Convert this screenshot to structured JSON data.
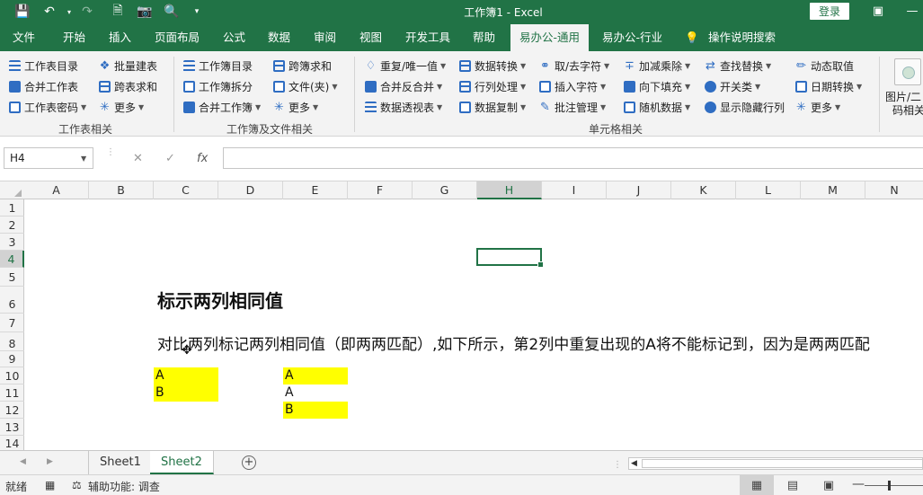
{
  "window": {
    "doc_title": "工作簿1  -  Excel",
    "login": "登录"
  },
  "ribbon_tabs": [
    "文件",
    "开始",
    "插入",
    "页面布局",
    "公式",
    "数据",
    "审阅",
    "视图",
    "开发工具",
    "帮助",
    "易办公-通用",
    "易办公-行业",
    "操作说明搜索"
  ],
  "ribbon": {
    "group1": {
      "label": "工作表相关",
      "items": [
        "工作表目录",
        "合并工作表",
        "工作表密码",
        "批量建表",
        "跨表求和",
        "更多"
      ]
    },
    "group2": {
      "label": "工作簿及文件相关",
      "items": [
        "工作簿目录",
        "工作簿拆分",
        "合并工作簿",
        "跨簿求和",
        "文件(夹)",
        "更多"
      ]
    },
    "group3": {
      "label": "单元格相关",
      "items": [
        "重复/唯一值",
        "合并反合并",
        "数据透视表",
        "数据转换",
        "行列处理",
        "数据复制",
        "取/去字符",
        "插入字符",
        "批注管理",
        "加减乘除",
        "向下填充",
        "随机数据",
        "查找替换",
        "开关类",
        "显示隐藏行列",
        "动态取值",
        "日期转换",
        "更多"
      ]
    },
    "big_button": {
      "line1": "图片/二",
      "line2": "码相关"
    }
  },
  "formula_bar": {
    "name_box": "H4",
    "cancel": "✕",
    "enter": "✓",
    "fx": "fx",
    "value": ""
  },
  "columns": [
    "A",
    "B",
    "C",
    "D",
    "E",
    "F",
    "G",
    "H",
    "I",
    "J",
    "K",
    "L",
    "M",
    "N"
  ],
  "rows": [
    "1",
    "2",
    "3",
    "4",
    "5",
    "6",
    "7",
    "8",
    "9",
    "10",
    "11",
    "12",
    "13",
    "14"
  ],
  "selected": {
    "col": "H",
    "row": "4"
  },
  "sheet": {
    "title": "标示两列相同值",
    "description": "对比两列标记两列相同值（即两两匹配）,如下所示，第2列中重复出现的A将不能标记到，因为是两两匹配",
    "col_c": [
      {
        "row": "10",
        "value": "A",
        "highlight": true
      },
      {
        "row": "11",
        "value": "B",
        "highlight": true
      }
    ],
    "col_e": [
      {
        "row": "10",
        "value": "A",
        "highlight": true
      },
      {
        "row": "11",
        "value": "A",
        "highlight": false
      },
      {
        "row": "12",
        "value": "B",
        "highlight": true
      }
    ],
    "highlight_color": "#ffff00"
  },
  "sheet_tabs": {
    "tabs": [
      "Sheet1",
      "Sheet2"
    ],
    "active": "Sheet2"
  },
  "status": {
    "ready": "就绪",
    "accessibility": "辅助功能: 调查"
  },
  "colors": {
    "accent": "#217346",
    "ribbon_bg": "#f3f3f3"
  }
}
